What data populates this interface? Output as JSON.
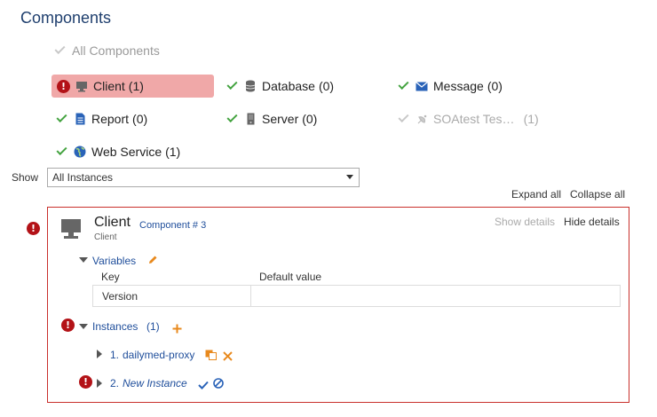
{
  "page": {
    "title": "Components"
  },
  "filters": {
    "all_components": "All Components",
    "categories": [
      {
        "label": "Client",
        "count": "(1)",
        "state": "error",
        "icon": "monitor-icon"
      },
      {
        "label": "Database",
        "count": "(0)",
        "state": "ok",
        "icon": "database-icon"
      },
      {
        "label": "Message",
        "count": "(0)",
        "state": "ok",
        "icon": "envelope-icon"
      },
      {
        "label": "Report",
        "count": "(0)",
        "state": "ok",
        "icon": "document-icon"
      },
      {
        "label": "Server",
        "count": "(0)",
        "state": "ok",
        "icon": "server-icon"
      },
      {
        "label": "SOAtest Tes…",
        "count": "(1)",
        "state": "disabled",
        "icon": "satellite-icon"
      },
      {
        "label": "Web Service",
        "count": "(1)",
        "state": "ok",
        "icon": "globe-icon"
      }
    ]
  },
  "show": {
    "label": "Show",
    "selected": "All Instances"
  },
  "actions": {
    "expand_all": "Expand all",
    "collapse_all": "Collapse all"
  },
  "component": {
    "name": "Client",
    "number": "Component # 3",
    "type": "Client",
    "show_details": "Show details",
    "hide_details": "Hide details",
    "variables": {
      "label": "Variables",
      "col_key": "Key",
      "col_default": "Default value",
      "rows": [
        {
          "key": "Version",
          "default": ""
        }
      ]
    },
    "instances": {
      "label": "Instances",
      "count": "(1)",
      "items": [
        {
          "number": "1.",
          "name": "dailymed-proxy"
        },
        {
          "number": "2.",
          "name": "New Instance"
        }
      ]
    }
  },
  "colors": {
    "error": "#b31217",
    "ok": "#44a340",
    "link": "#1f4e9b",
    "selected_bg": "#f0a8a8",
    "panel_border": "#c9302c",
    "title": "#1f3f6e",
    "accent_orange": "#e8891d"
  }
}
